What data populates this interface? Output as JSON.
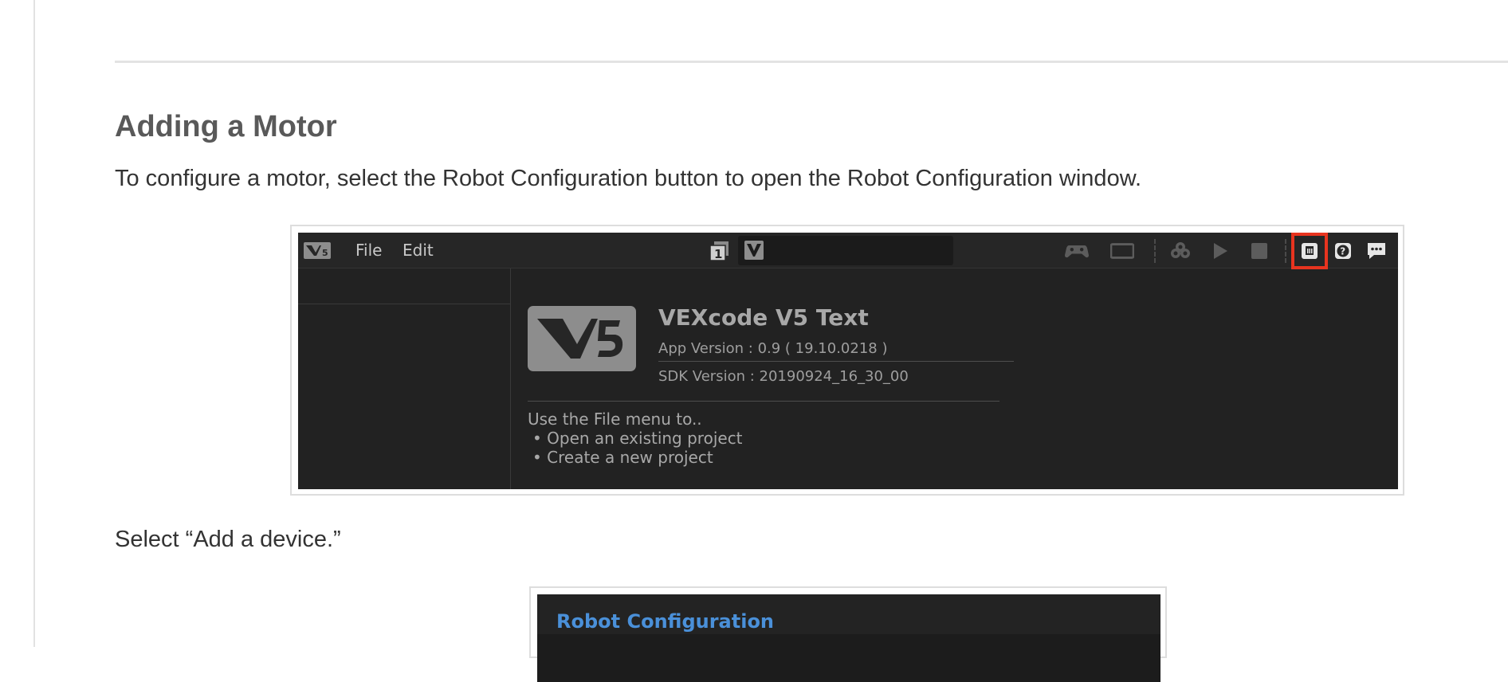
{
  "article": {
    "heading": "Adding a Motor",
    "paragraph1": "To configure a motor, select the Robot Configuration button to open the Robot Configuration window.",
    "paragraph2": "Select “Add a device.”"
  },
  "screenshot1": {
    "menu": {
      "file": "File",
      "edit": "Edit"
    },
    "slot_number": "1",
    "toolbar_icons": [
      "controller-icon",
      "brain-screen-icon",
      "download-icon",
      "play-icon",
      "stop-icon",
      "robot-configuration-icon",
      "help-icon",
      "feedback-icon"
    ],
    "highlighted_button": "robot-configuration-icon",
    "highlight_color": "#e8341f",
    "welcome": {
      "title": "VEXcode V5 Text",
      "app_version": "App Version : 0.9 ( 19.10.0218 )",
      "sdk_version": "SDK Version : 20190924_16_30_00",
      "hint": "Use the File menu to..",
      "bullets": [
        "• Open an existing project",
        "• Create a new project"
      ]
    }
  },
  "screenshot2": {
    "title": "Robot Configuration",
    "title_color": "#4a90d9"
  }
}
